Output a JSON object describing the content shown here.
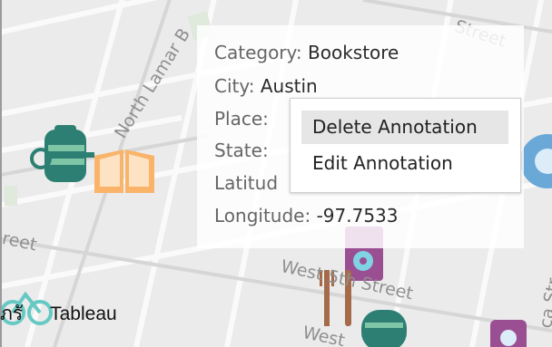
{
  "map": {
    "streets": [
      "North Lamar B",
      "Street",
      "reet",
      "West 5th Street",
      "West",
      "Street",
      "ca Str"
    ],
    "colors": {
      "book": "#f9b46a",
      "teapot": "#2e7f73",
      "pin_purple": "#9b4f93",
      "fork": "#a56a4a",
      "bike": "#66c9c4"
    }
  },
  "tooltip": {
    "rows": [
      {
        "label": "Category: ",
        "value": "Bookstore"
      },
      {
        "label": "City: ",
        "value": "Austin"
      },
      {
        "label": "Place: ",
        "value": ""
      },
      {
        "label": "State: ",
        "value": ""
      },
      {
        "label": "Latitud",
        "value": ""
      },
      {
        "label": "Longitude: ",
        "value": "-97.7533"
      }
    ]
  },
  "context_menu": {
    "items": [
      "Delete Annotation",
      "Edit Annotation"
    ]
  },
  "caption": {
    "prefix": "ภรั",
    "text": "Tableau"
  }
}
